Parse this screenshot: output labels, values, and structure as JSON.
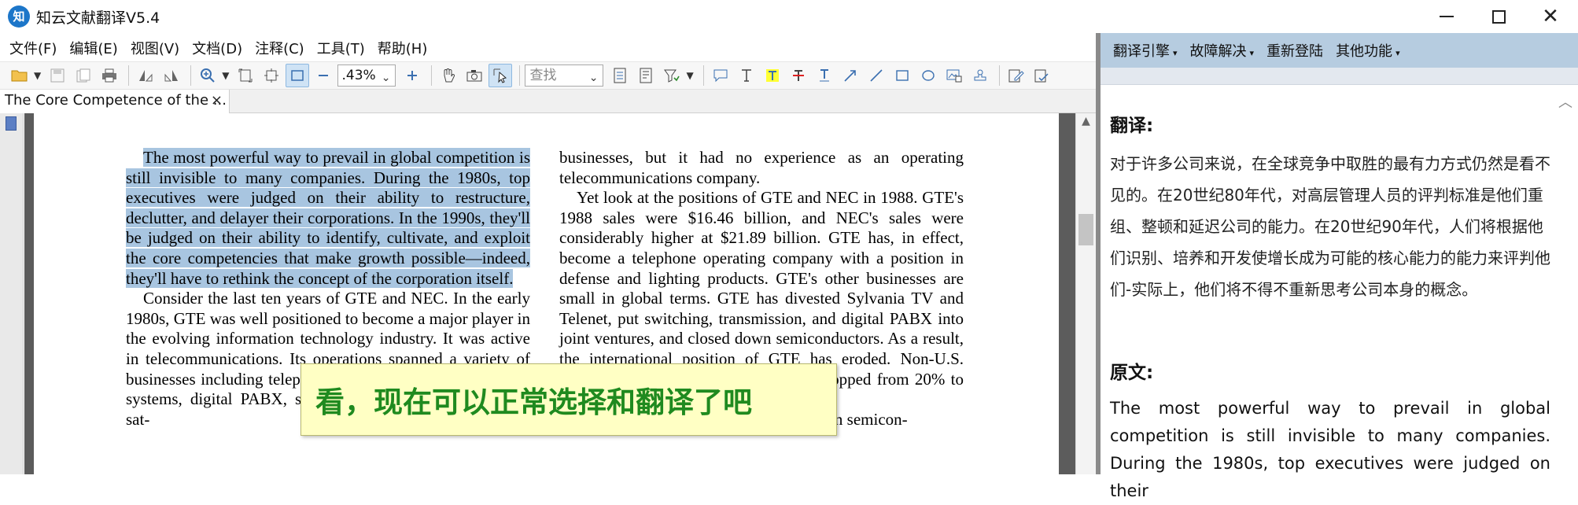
{
  "window": {
    "app_icon_text": "知",
    "title": "知云文献翻译V5.4"
  },
  "menu": [
    "文件(F)",
    "编辑(E)",
    "视图(V)",
    "文档(D)",
    "注释(C)",
    "工具(T)",
    "帮助(H)"
  ],
  "toolbar": {
    "zoom": ".43%",
    "search_placeholder": "查找"
  },
  "tab": {
    "title": "The Core Competence of the ...",
    "close": "×"
  },
  "document": {
    "col1": [
      "The most powerful way to prevail in global competition is still invisible to many companies. During the 1980s, top executives were judged on their ability to restructure, declutter, and delayer their corporations. In the 1990s, they'll be judged on their ability to identify, cultivate, and exploit the core competencies that make growth possible—indeed, they'll have to rethink the concept of the corporation itself.",
      "Consider the last ten years of GTE and NEC. In the early 1980s, GTE was well positioned to become a major player in the evolving information technology industry. It was active in telecommunications. Its operations spanned a variety of businesses including telephones, switching and transmission systems, digital PABX, semiconductors, packet switching, sat-"
    ],
    "col2": [
      "businesses, but it had no experience as an operating telecommunications company.",
      "Yet look at the positions of GTE and NEC in 1988. GTE's 1988 sales were $16.46 billion, and NEC's sales were considerably higher at $21.89 billion. GTE has, in effect, become a telephone operating company with a position in defense and lighting products. GTE's other businesses are small in global terms. GTE has divested Sylvania TV and Telenet, put switching, transmission, and digital PABX into joint ventures, and closed down semiconductors. As a result, the international position of GTE has eroded. Non-U.S. revenue as a percent of total revenue dropped from 20% to 15% between 1980 and 1988.",
      "NEC has emerged as the world leader in semicon-"
    ]
  },
  "overlay_text": "看，现在可以正常选择和翻译了吧",
  "translation_panel": {
    "menus": [
      "翻译引擎",
      "故障解决",
      "重新登陆",
      "其他功能"
    ],
    "translation_heading": "翻译:",
    "translation_text": "对于许多公司来说，在全球竞争中取胜的最有力方式仍然是看不见的。在20世纪80年代，对高层管理人员的评判标准是他们重组、整顿和延迟公司的能力。在20世纪90年代，人们将根据他们识别、培养和开发使增长成为可能的核心能力的能力来评判他们-实际上，他们将不得不重新思考公司本身的概念。",
    "original_heading": "原文:",
    "original_text": "The most powerful way to prevail in global competition is still invisible to many companies. During the 1980s, top executives were judged on their"
  }
}
